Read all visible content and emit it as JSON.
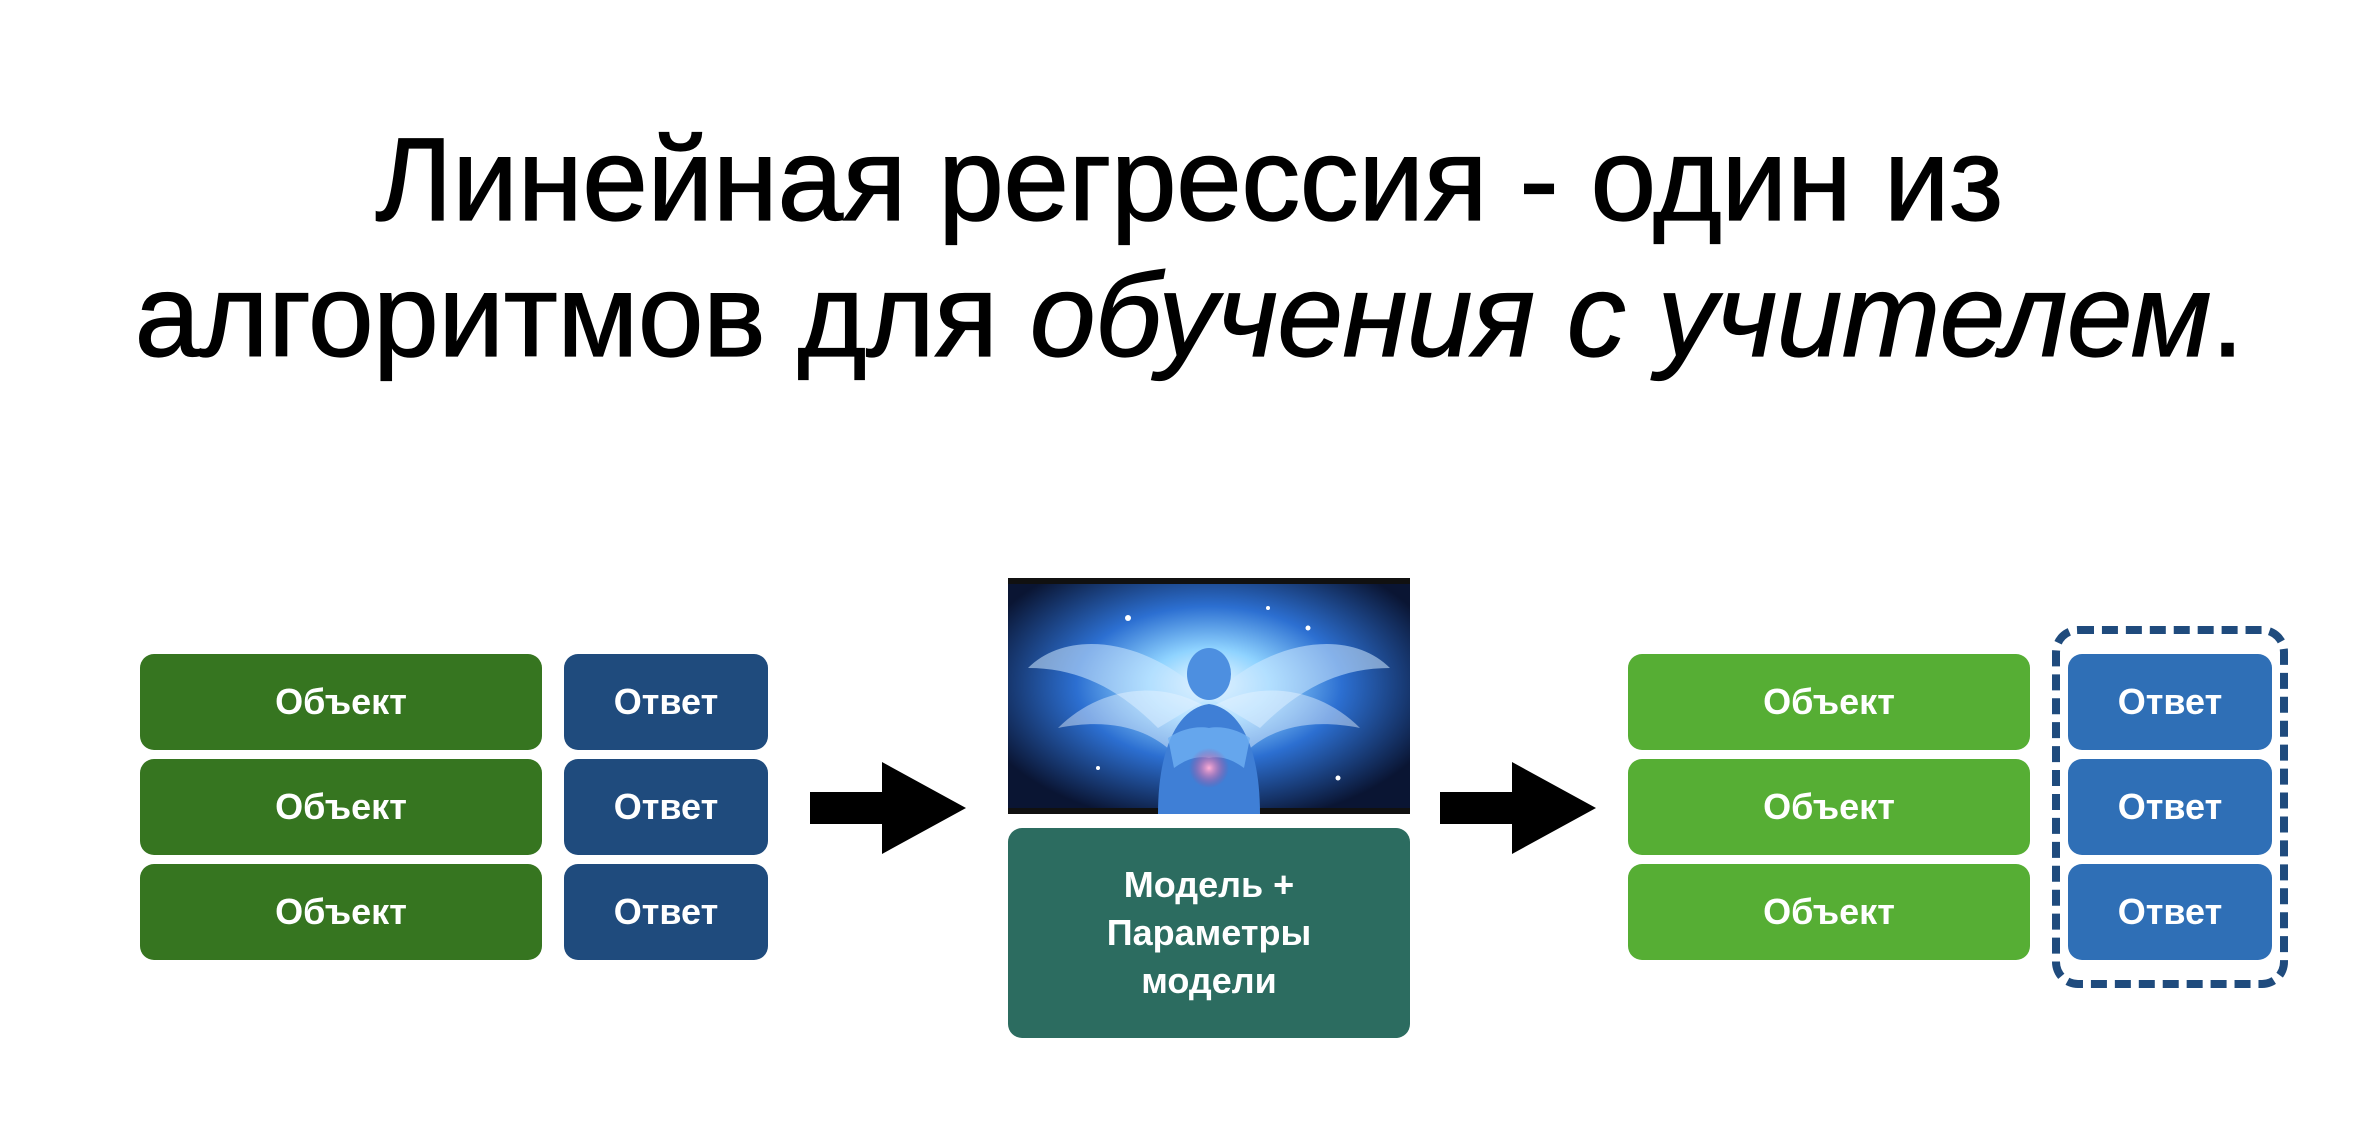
{
  "title": {
    "line1": "Линейная регрессия - один из",
    "line2_plain": "алгоритмов для ",
    "line2_italic": "обучения с учителем",
    "line2_end": "."
  },
  "input_table": {
    "rows": [
      {
        "object": "Объект",
        "answer": "Ответ"
      },
      {
        "object": "Объект",
        "answer": "Ответ"
      },
      {
        "object": "Объект",
        "answer": "Ответ"
      }
    ]
  },
  "model": {
    "lines": [
      "Модель +",
      "Параметры",
      "модели"
    ]
  },
  "output_table": {
    "rows": [
      {
        "object": "Объект",
        "answer": "Ответ"
      },
      {
        "object": "Объект",
        "answer": "Ответ"
      },
      {
        "object": "Объект",
        "answer": "Ответ"
      }
    ]
  },
  "colors": {
    "input_object": "#367520",
    "input_answer": "#1f4b7d",
    "model": "#2c6c60",
    "output_object": "#56ae34",
    "output_answer": "#2f6fb6",
    "dashed_frame": "#1f4b7d",
    "arrow": "#000000"
  },
  "icons": {
    "arrow_1": "right-arrow-icon",
    "arrow_2": "right-arrow-icon",
    "picture": "glowing-figure-illustration"
  }
}
